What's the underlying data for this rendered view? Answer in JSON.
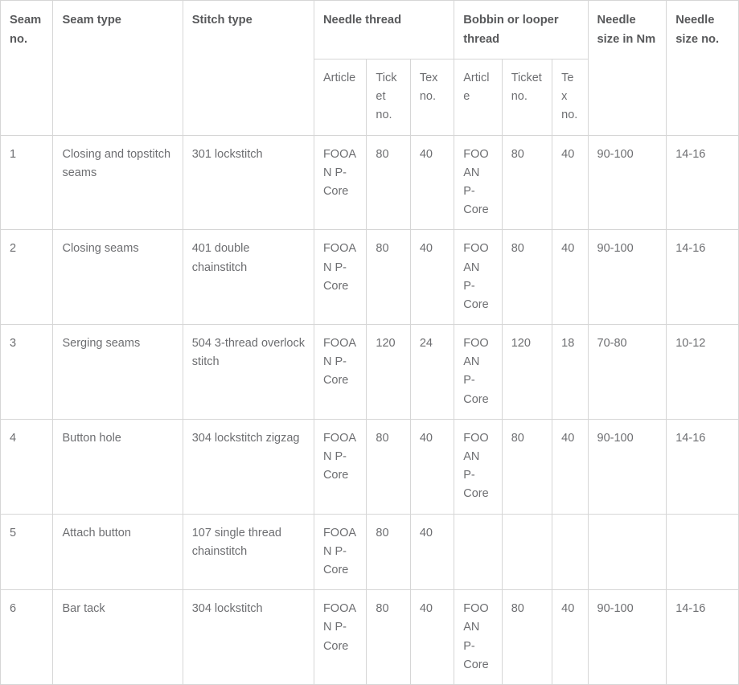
{
  "table": {
    "group_headers": [
      {
        "key": "seam_no",
        "label": "Seam no."
      },
      {
        "key": "seam_type",
        "label": "Seam type"
      },
      {
        "key": "stitch_type",
        "label": "Stitch type"
      },
      {
        "key": "needle_thread",
        "label": "Needle thread"
      },
      {
        "key": "bobbin_thread",
        "label": "Bobbin or looper thread"
      },
      {
        "key": "needle_size_nm",
        "label": "Needle size in Nm"
      },
      {
        "key": "needle_size_no",
        "label": "Needle size no."
      }
    ],
    "sub_headers": {
      "blank1": "",
      "blank2": "",
      "blank3": "",
      "nt_article": "Article",
      "nt_ticket": "Ticket no.",
      "nt_tex": "Tex no.",
      "bt_article": "Article",
      "bt_ticket": "Ticket no.",
      "bt_tex": "Tex no.",
      "blank4": "",
      "blank5": ""
    },
    "rows": [
      {
        "seam_no": "1",
        "seam_type": "Closing and topstitch seams",
        "stitch_type": "301 lockstitch",
        "nt_article": "FOOAN P-Core",
        "nt_ticket": "80",
        "nt_tex": "40",
        "bt_article": "FOOAN P-Core",
        "bt_ticket": "80",
        "bt_tex": "40",
        "needle_size_nm": "90-100",
        "needle_size_no": "14-16"
      },
      {
        "seam_no": "2",
        "seam_type": "Closing seams",
        "stitch_type": "401 double chainstitch",
        "nt_article": "FOOAN P-Core",
        "nt_ticket": "80",
        "nt_tex": "40",
        "bt_article": "FOOAN P-Core",
        "bt_ticket": "80",
        "bt_tex": "40",
        "needle_size_nm": "90-100",
        "needle_size_no": "14-16"
      },
      {
        "seam_no": "3",
        "seam_type": "Serging seams",
        "stitch_type": "504 3-thread overlock stitch",
        "nt_article": "FOOAN P-Core",
        "nt_ticket": "120",
        "nt_tex": "24",
        "bt_article": "FOOAN P-Core",
        "bt_ticket": "120",
        "bt_tex": "18",
        "needle_size_nm": "70-80",
        "needle_size_no": "10-12"
      },
      {
        "seam_no": "4",
        "seam_type": "Button hole",
        "stitch_type": "304 lockstitch zigzag",
        "nt_article": "FOOAN P-Core",
        "nt_ticket": "80",
        "nt_tex": "40",
        "bt_article": "FOOAN P-Core",
        "bt_ticket": "80",
        "bt_tex": "40",
        "needle_size_nm": "90-100",
        "needle_size_no": "14-16"
      },
      {
        "seam_no": "5",
        "seam_type": "Attach button",
        "stitch_type": "107 single thread chainstitch",
        "nt_article": "FOOAN P-Core",
        "nt_ticket": "80",
        "nt_tex": "40",
        "bt_article": "",
        "bt_ticket": "",
        "bt_tex": "",
        "needle_size_nm": "",
        "needle_size_no": ""
      },
      {
        "seam_no": "6",
        "seam_type": "Bar tack",
        "stitch_type": "304 lockstitch",
        "nt_article": "FOOAN P-Core",
        "nt_ticket": "80",
        "nt_tex": "40",
        "bt_article": "FOOAN P-Core",
        "bt_ticket": "80",
        "bt_tex": "40",
        "needle_size_nm": "90-100",
        "needle_size_no": "14-16"
      }
    ]
  },
  "colors": {
    "border": "#d6d6d6",
    "header_text": "#58595b",
    "body_text": "#6d6e71",
    "background": "#ffffff"
  }
}
